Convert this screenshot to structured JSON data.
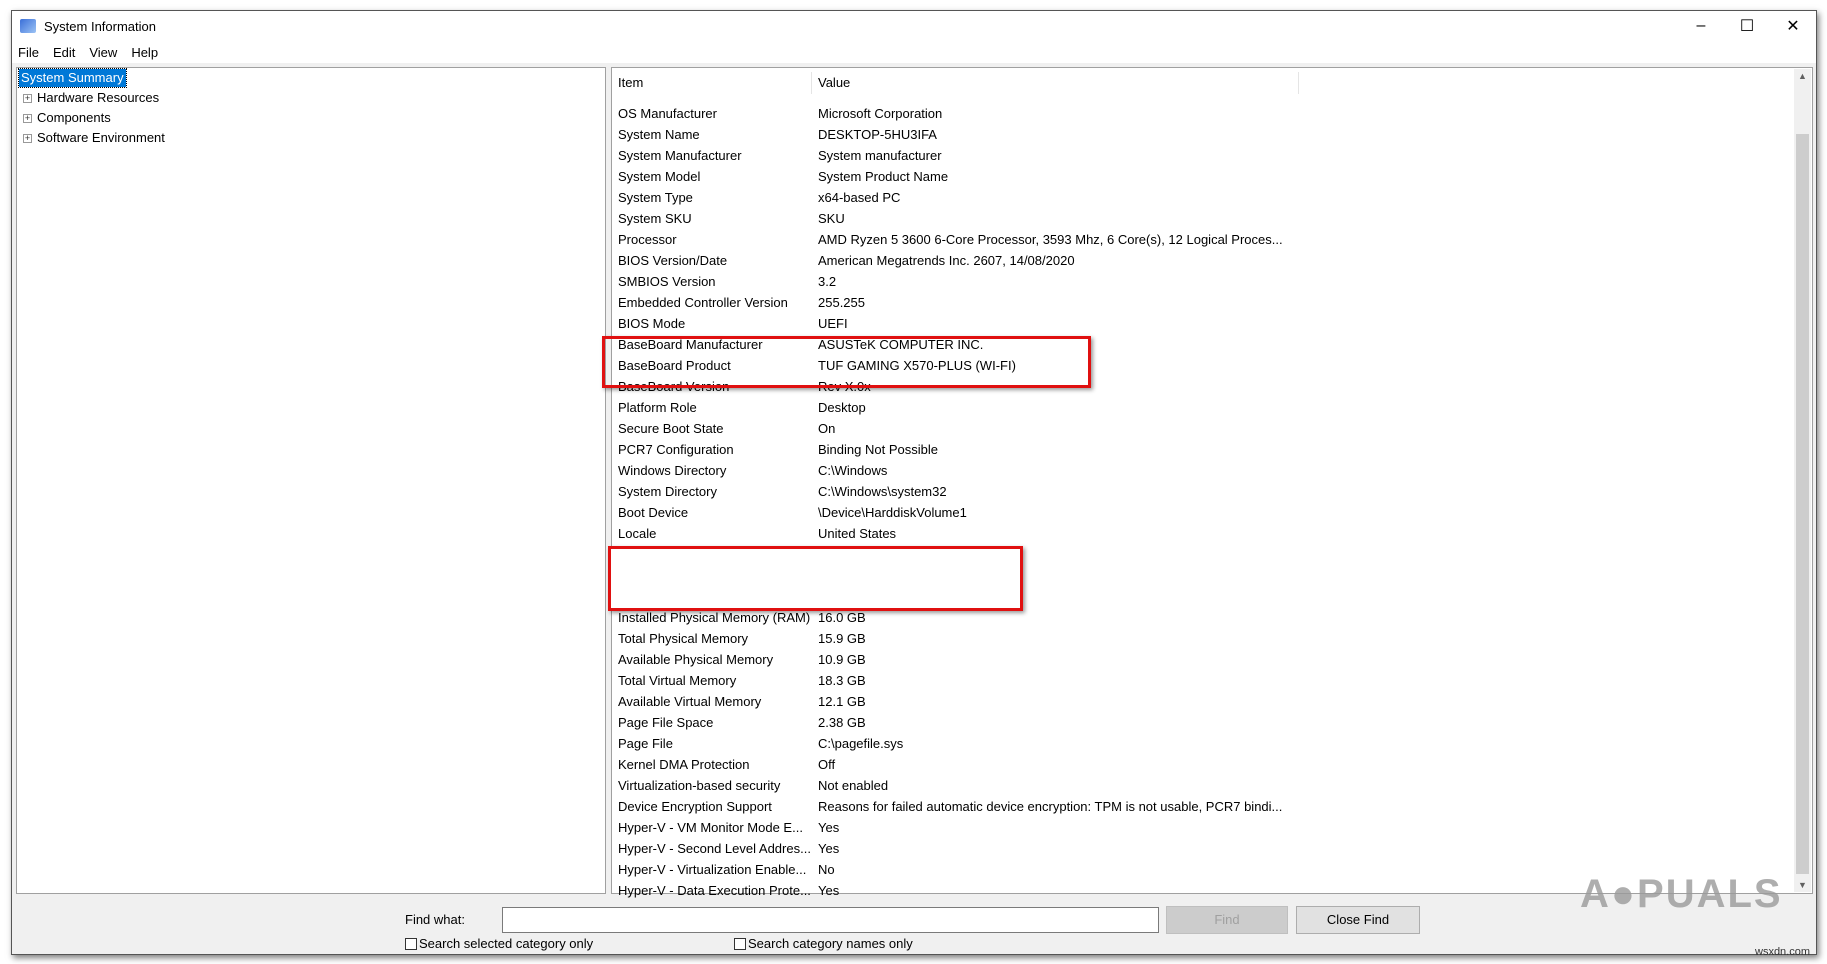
{
  "window": {
    "title": "System Information",
    "controls": [
      "minimize",
      "maximize",
      "close"
    ]
  },
  "menu": [
    "File",
    "Edit",
    "View",
    "Help"
  ],
  "tree": {
    "selected": "System Summary",
    "children": [
      "Hardware Resources",
      "Components",
      "Software Environment"
    ]
  },
  "list": {
    "headers": [
      "Item",
      "Value"
    ],
    "rows": [
      [
        "OS Manufacturer",
        "Microsoft Corporation"
      ],
      [
        "System Name",
        "DESKTOP-5HU3IFA"
      ],
      [
        "System Manufacturer",
        "System manufacturer"
      ],
      [
        "System Model",
        "System Product Name"
      ],
      [
        "System Type",
        "x64-based PC"
      ],
      [
        "System SKU",
        "SKU"
      ],
      [
        "Processor",
        "AMD Ryzen 5 3600 6-Core Processor, 3593 Mhz, 6 Core(s), 12 Logical Proces..."
      ],
      [
        "BIOS Version/Date",
        "American Megatrends Inc. 2607, 14/08/2020"
      ],
      [
        "SMBIOS Version",
        "3.2"
      ],
      [
        "Embedded Controller Version",
        "255.255"
      ],
      [
        "BIOS Mode",
        "UEFI"
      ],
      [
        "BaseBoard Manufacturer",
        "ASUSTeK COMPUTER INC."
      ],
      [
        "BaseBoard Product",
        "TUF GAMING X570-PLUS (WI-FI)"
      ],
      [
        "BaseBoard Version",
        "Rev X.0x"
      ],
      [
        "Platform Role",
        "Desktop"
      ],
      [
        "Secure Boot State",
        "On"
      ],
      [
        "PCR7 Configuration",
        "Binding Not Possible"
      ],
      [
        "Windows Directory",
        "C:\\Windows"
      ],
      [
        "System Directory",
        "C:\\Windows\\system32"
      ],
      [
        "Boot Device",
        "\\Device\\HarddiskVolume1"
      ],
      [
        "Locale",
        "United States"
      ],
      [
        "",
        ""
      ],
      [
        "",
        ""
      ],
      [
        "",
        ""
      ],
      [
        "Installed Physical Memory (RAM)",
        "16.0 GB"
      ],
      [
        "Total Physical Memory",
        "15.9 GB"
      ],
      [
        "Available Physical Memory",
        "10.9 GB"
      ],
      [
        "Total Virtual Memory",
        "18.3 GB"
      ],
      [
        "Available Virtual Memory",
        "12.1 GB"
      ],
      [
        "Page File Space",
        "2.38 GB"
      ],
      [
        "Page File",
        "C:\\pagefile.sys"
      ],
      [
        "Kernel DMA Protection",
        "Off"
      ],
      [
        "Virtualization-based security",
        "Not enabled"
      ],
      [
        "Device Encryption Support",
        "Reasons for failed automatic device encryption: TPM is not usable, PCR7 bindi..."
      ],
      [
        "Hyper-V - VM Monitor Mode E...",
        "Yes"
      ],
      [
        "Hyper-V - Second Level Addres...",
        "Yes"
      ],
      [
        "Hyper-V - Virtualization Enable...",
        "No"
      ],
      [
        "Hyper-V - Data Execution Prote...",
        "Yes"
      ]
    ]
  },
  "find": {
    "label": "Find what:",
    "value": "",
    "find_button": "Find",
    "close_button": "Close Find",
    "check1": "Search selected category only",
    "check2": "Search category names only"
  },
  "watermark": {
    "logo": "APPUALS",
    "site": "wsxdn.com"
  },
  "colors": {
    "selection": "#0078d7",
    "highlight_box": "#e01010"
  }
}
